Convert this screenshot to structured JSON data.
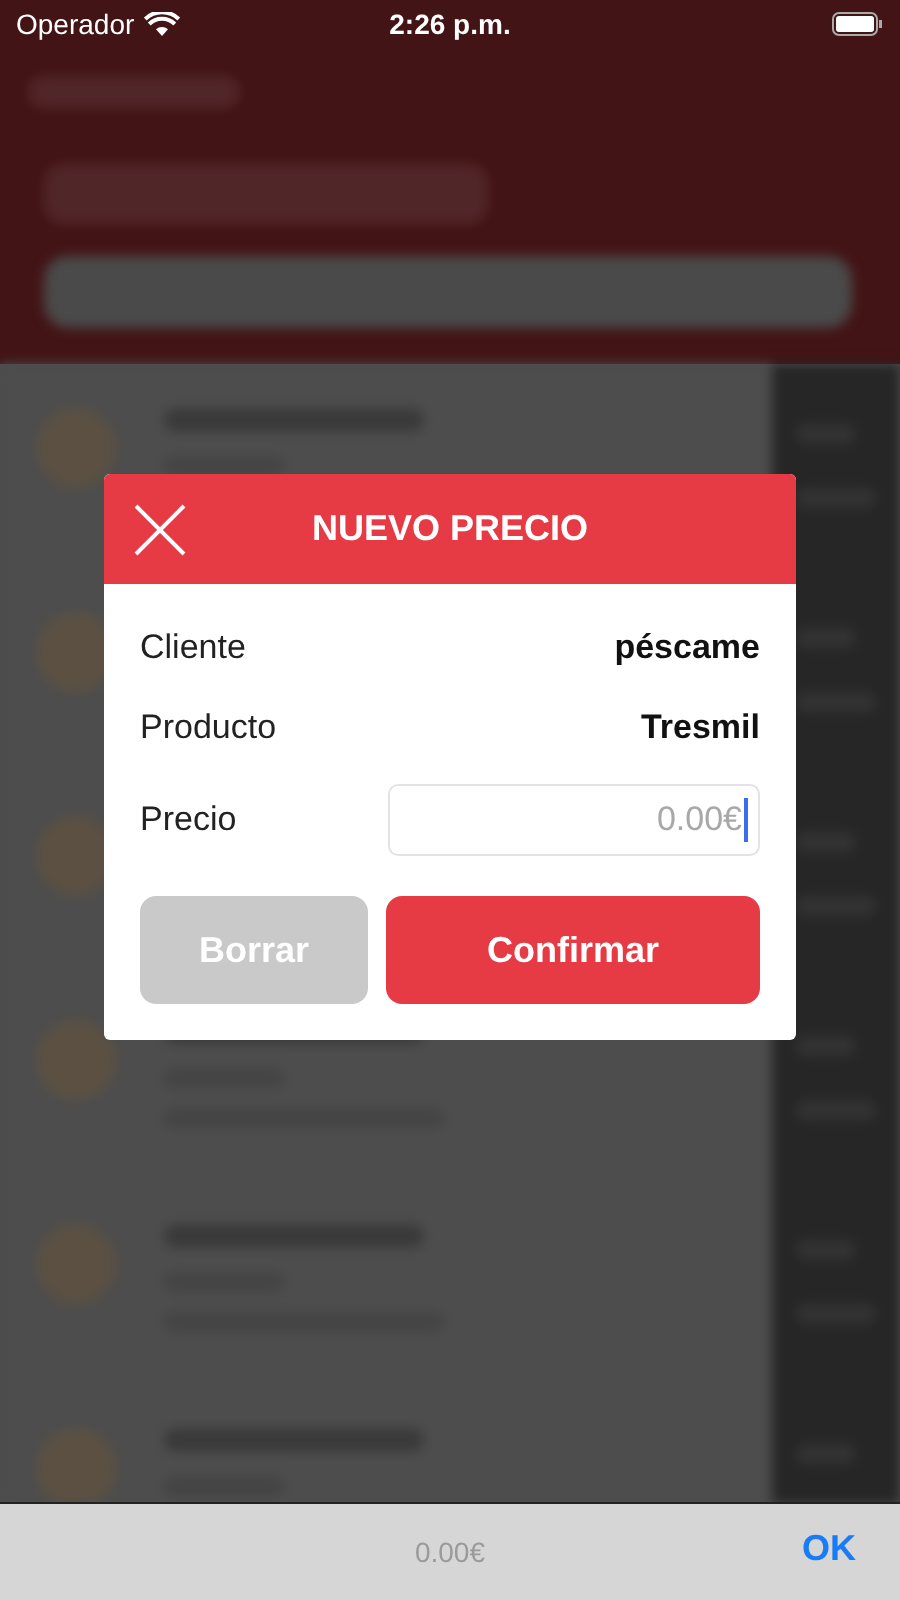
{
  "status_bar": {
    "carrier": "Operador",
    "time": "2:26 p.m."
  },
  "dialog": {
    "title": "NUEVO PRECIO",
    "rows": [
      {
        "label": "Cliente",
        "value": "péscame"
      },
      {
        "label": "Producto",
        "value": "Tresmil"
      }
    ],
    "price": {
      "label": "Precio",
      "placeholder": "0.00€"
    },
    "buttons": [
      {
        "label": "Borrar",
        "disabled": true
      },
      {
        "label": "Confirmar",
        "disabled": false
      }
    ]
  },
  "keyboard_bar": {
    "value": "0.00€",
    "button": "OK"
  }
}
